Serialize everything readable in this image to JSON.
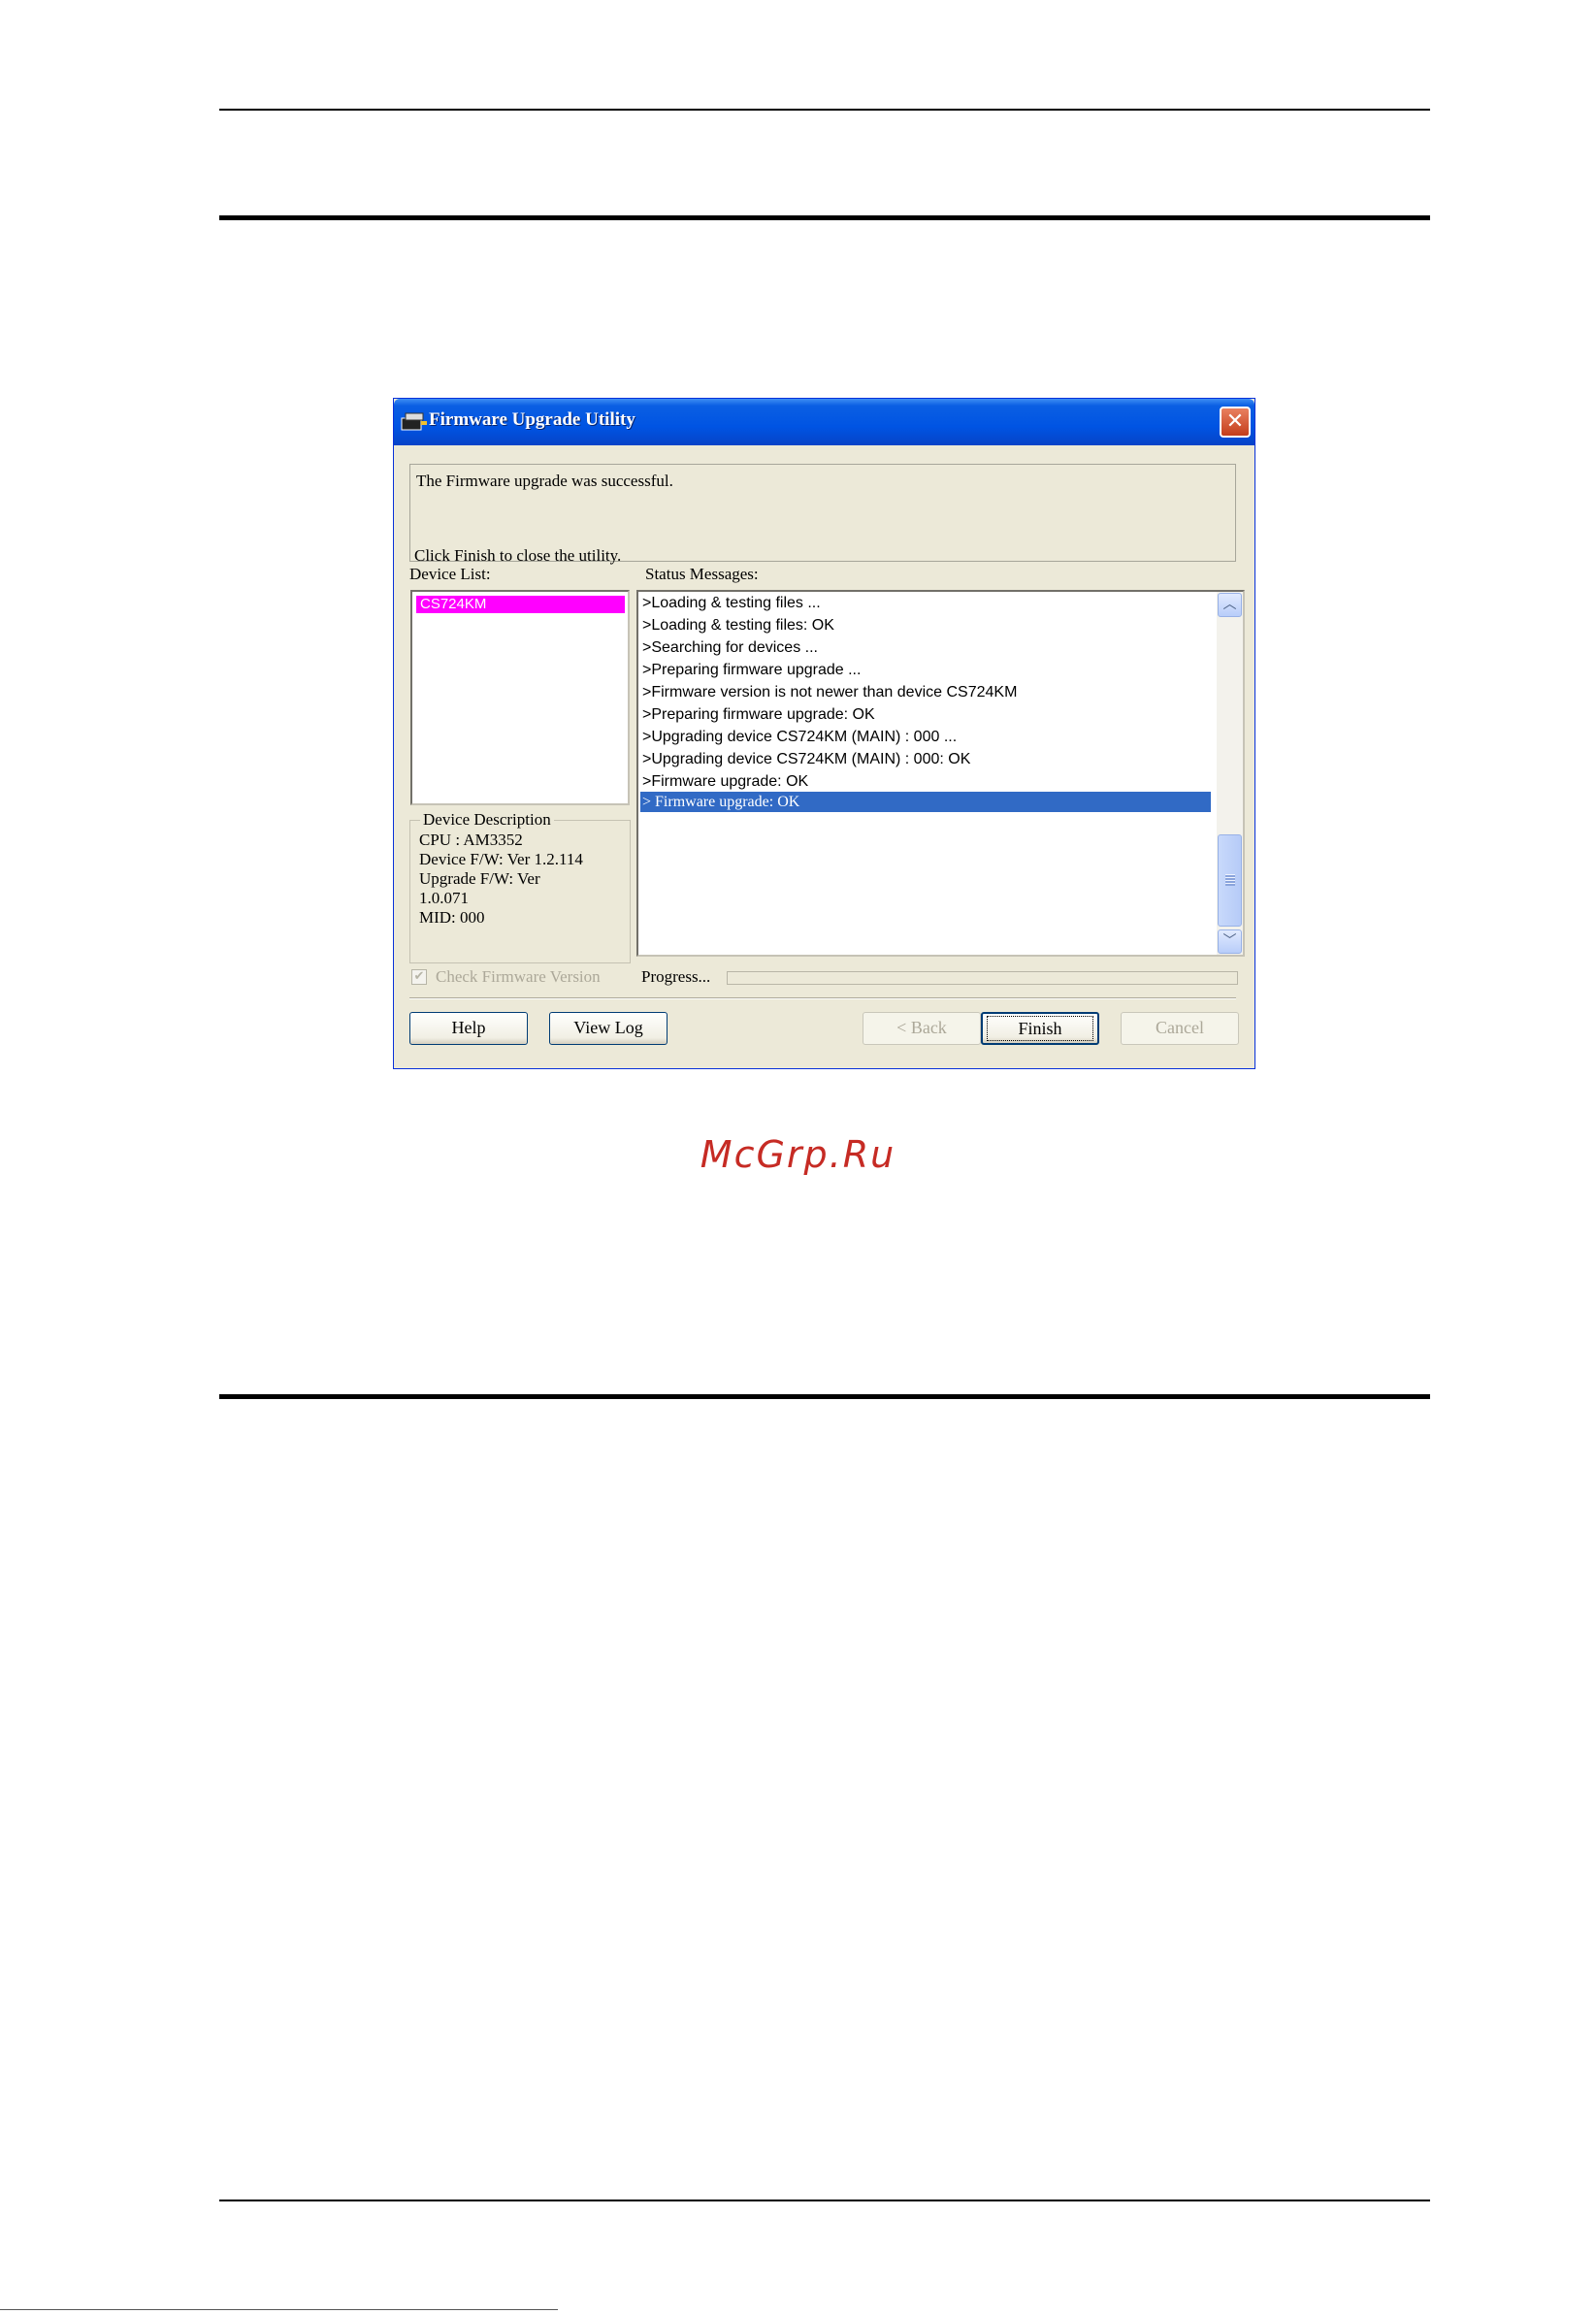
{
  "watermark": "McGrp.Ru",
  "dialog": {
    "title": "Firmware Upgrade Utility",
    "close_label": "✕",
    "message_line1": "The Firmware upgrade was successful.",
    "message_line2": "Click Finish to close the utility.",
    "device_list_label": "Device List:",
    "status_messages_label": "Status Messages:",
    "devices": [
      "CS724KM"
    ],
    "device_description": {
      "legend": "Device Description",
      "lines": [
        "CPU : AM3352",
        "Device F/W: Ver 1.2.114",
        "Upgrade F/W: Ver",
        "1.0.071",
        "MID: 000"
      ]
    },
    "status_messages": [
      ">Loading & testing files ...",
      ">Loading & testing files: OK",
      ">Searching for devices ...",
      ">Preparing firmware upgrade ...",
      ">Firmware version is not newer than device CS724KM",
      ">Preparing firmware upgrade: OK",
      ">Upgrading device CS724KM (MAIN) : 000 ...",
      ">Upgrading device CS724KM (MAIN) : 000: OK",
      ">Firmware upgrade: OK",
      "> Firmware upgrade: OK"
    ],
    "selected_status_index": 9,
    "check_firmware_version": {
      "label": "Check Firmware Version",
      "checked": true,
      "enabled": false
    },
    "progress": {
      "label": "Progress...",
      "value": 0
    },
    "buttons": {
      "help": "Help",
      "view_log": "View Log",
      "back": "< Back",
      "finish": "Finish",
      "cancel": "Cancel"
    },
    "colors": {
      "title_bar": "#0054e3",
      "selected_device": "#ff00ff",
      "selected_status": "#316ac5"
    }
  }
}
